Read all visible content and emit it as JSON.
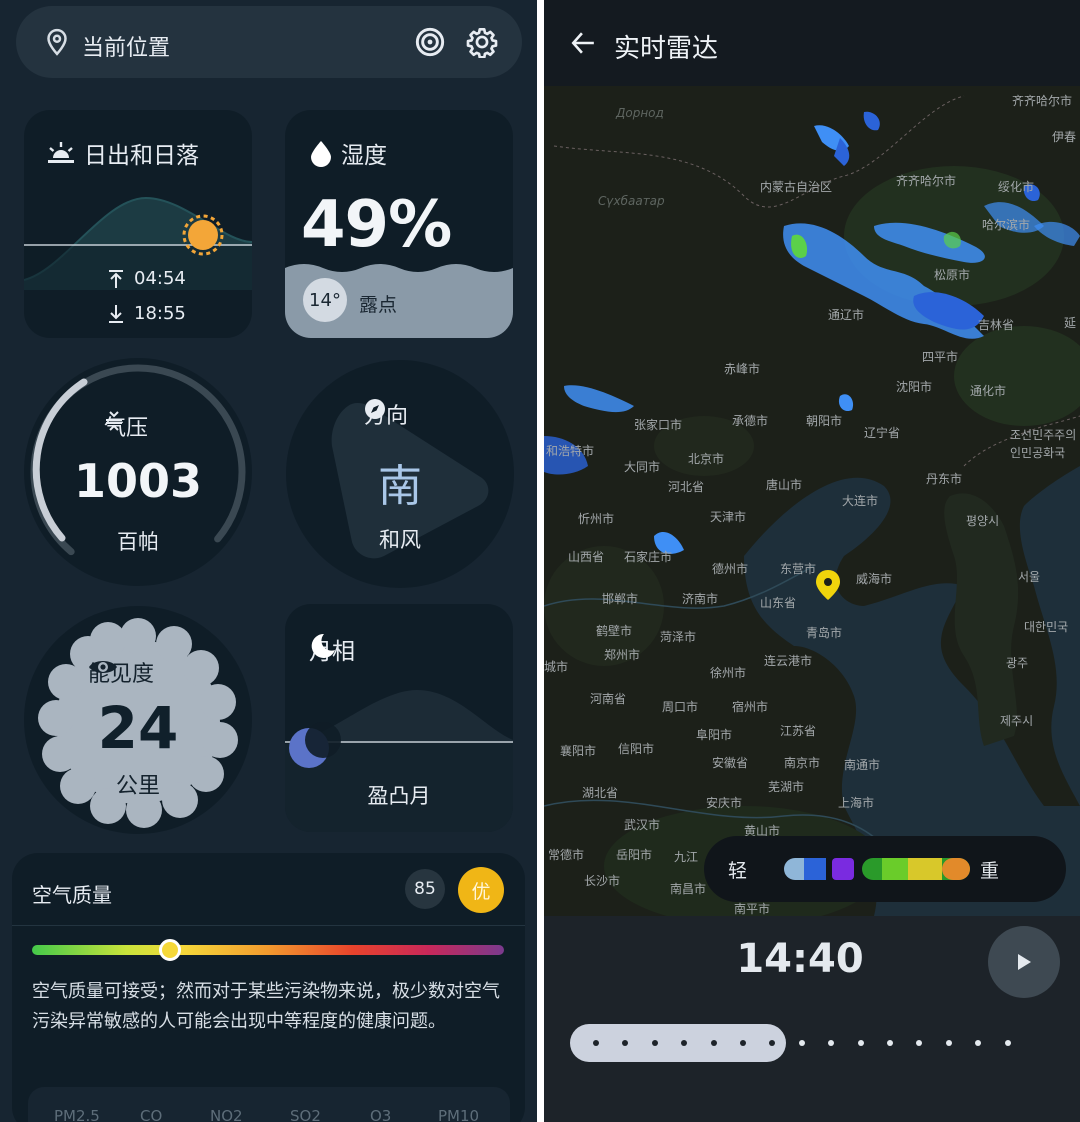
{
  "left": {
    "topbar": {
      "location": "当前位置",
      "icons": [
        "pin-icon",
        "radar-icon",
        "gear-icon"
      ]
    },
    "sunrise": {
      "title": "日出和日落",
      "sunrise": "04:54",
      "sunset": "18:55"
    },
    "humidity": {
      "title": "湿度",
      "value": "49%",
      "dew_point": "14°",
      "dew_label": "露点",
      "level": 0.49
    },
    "pressure": {
      "title": "气压",
      "value": "1003",
      "unit": "百帕"
    },
    "direction": {
      "title": "方向",
      "value": "南",
      "desc": "和风"
    },
    "visibility": {
      "title": "能见度",
      "value": "24",
      "unit": "公里"
    },
    "moon": {
      "title": "月相",
      "phase": "盈凸月"
    },
    "air_quality": {
      "title": "空气质量",
      "index": "85",
      "badge": "优",
      "badge_color": "#f0b616",
      "index_position": 0.3,
      "description": "空气质量可接受；然而对于某些污染物来说，极少数对空气污染异常敏感的人可能会出现中等程度的健康问题。",
      "pollutants": [
        "PM2.5",
        "CO",
        "NO2",
        "SO2",
        "O3",
        "PM10"
      ]
    }
  },
  "right": {
    "title": "实时雷达",
    "map_labels": [
      "Дорнод",
      "Сүхбаатар",
      "内蒙古自治区",
      "齐齐哈尔市",
      "绥化市",
      "哈尔滨市",
      "松原市",
      "吉林省",
      "四平市",
      "通辽市",
      "赤峰市",
      "沈阳市",
      "通化市",
      "张家口市",
      "承德市",
      "朝阳市",
      "辽宁省",
      "和浩特市",
      "大同市",
      "北京市",
      "河北省",
      "唐山市",
      "丹东市",
      "忻州市",
      "天津市",
      "大连市",
      "山西省",
      "石家庄市",
      "德州市",
      "东营市",
      "威海市",
      "邯郸市",
      "济南市",
      "山东省",
      "青岛市",
      "鹤壁市",
      "菏泽市",
      "郑州市",
      "连云港市",
      "徐州市",
      "河南省",
      "周口市",
      "宿州市",
      "阜阳市",
      "江苏省",
      "襄阳市",
      "信阳市",
      "安徽省",
      "南京市",
      "南通市",
      "芜湖市",
      "湖北省",
      "安庆市",
      "上海市",
      "武汉市",
      "黄山市",
      "常德市",
      "岳阳市",
      "九江",
      "长沙市",
      "南昌市",
      "南平市",
      "조선민주주의인민공화국",
      "평양시",
      "서울",
      "대한민국",
      "광주",
      "제주시",
      "伊春",
      "齐齐哈尔市",
      "延",
      "城市"
    ],
    "legend": {
      "light": "轻",
      "heavy": "重",
      "colors": [
        "#8fb6d8",
        "#2b63d8",
        "#7a2be0",
        "#2a9a2a",
        "#6acc2a",
        "#d8c82a",
        "#e28a2a"
      ]
    },
    "time": "14:40",
    "timeline": {
      "position": 0.25,
      "steps": 15
    }
  }
}
